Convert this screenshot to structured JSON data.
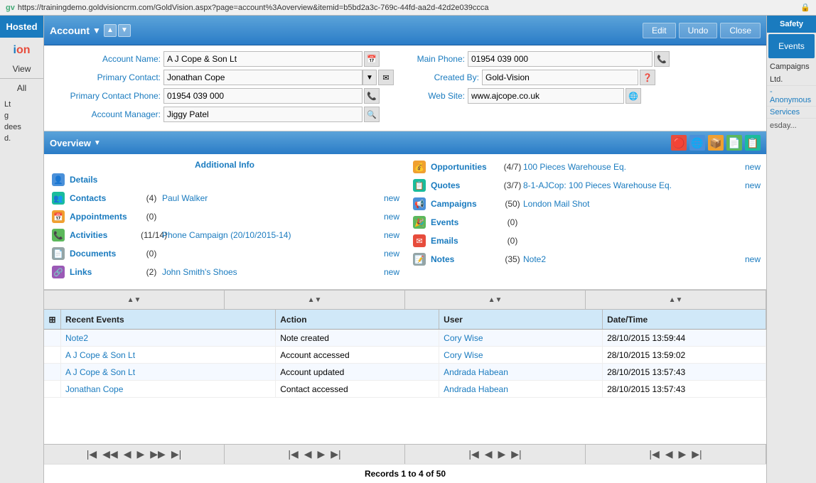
{
  "browser": {
    "url": "https://trainingdemo.goldvisioncrm.com/GoldVision.aspx?page=account%3Aoverview&itemid=b5bd2a3c-769c-44fd-aa2d-42d2e039ccca",
    "favicon": "gv"
  },
  "sidebar": {
    "hosted_label": "Hosted",
    "logo": "ion",
    "view_label": "View",
    "all_label": "All",
    "items": [
      {
        "label": "Lt"
      },
      {
        "label": "g"
      },
      {
        "label": "dees"
      },
      {
        "label": "d."
      }
    ]
  },
  "account": {
    "title": "Account",
    "dropdown_icon": "▼",
    "up_icon": "▲",
    "down_icon": "▼",
    "edit_label": "Edit",
    "undo_label": "Undo",
    "close_label": "Close"
  },
  "form": {
    "account_name_label": "Account Name:",
    "account_name_value": "A J Cope & Son Lt",
    "primary_contact_label": "Primary Contact:",
    "primary_contact_value": "Jonathan Cope",
    "primary_contact_phone_label": "Primary Contact Phone:",
    "primary_contact_phone_value": "01954 039 000",
    "account_manager_label": "Account Manager:",
    "account_manager_value": "Jiggy Patel",
    "main_phone_label": "Main Phone:",
    "main_phone_value": "01954 039 000",
    "created_by_label": "Created By:",
    "created_by_value": "Gold-Vision",
    "web_site_label": "Web Site:",
    "web_site_value": "www.ajcope.co.uk"
  },
  "overview": {
    "title": "Overview",
    "dropdown_icon": "▼",
    "icons": [
      "🔴",
      "🌐",
      "📦",
      "📄",
      "📋"
    ]
  },
  "overview_left": {
    "additional_info_title": "Additional Info",
    "items": [
      {
        "icon": "👤",
        "label": "Details",
        "count": "",
        "link": "",
        "new_label": ""
      },
      {
        "icon": "👥",
        "label": "Contacts",
        "count": "(4)",
        "link": "Paul Walker",
        "new_label": "new"
      },
      {
        "icon": "📅",
        "label": "Appointments",
        "count": "(0)",
        "link": "",
        "new_label": "new"
      },
      {
        "icon": "📞",
        "label": "Activities",
        "count": "(11/14)",
        "link": "Phone Campaign (20/10/2015-14)",
        "new_label": "new"
      },
      {
        "icon": "📄",
        "label": "Documents",
        "count": "(0)",
        "link": "",
        "new_label": "new"
      },
      {
        "icon": "🔗",
        "label": "Links",
        "count": "(2)",
        "link": "John Smith's Shoes",
        "new_label": "new"
      }
    ]
  },
  "overview_right": {
    "items": [
      {
        "icon": "💰",
        "label": "Opportunities",
        "count": "(4/7)",
        "link": "100 Pieces Warehouse Eq.",
        "new_label": "new"
      },
      {
        "icon": "📋",
        "label": "Quotes",
        "count": "(3/7)",
        "link": "8-1-AJCop: 100 Pieces Warehouse Eq.",
        "new_label": "new"
      },
      {
        "icon": "📢",
        "label": "Campaigns",
        "count": "(50)",
        "link": "London Mail Shot",
        "new_label": ""
      },
      {
        "icon": "🎉",
        "label": "Events",
        "count": "(0)",
        "link": "",
        "new_label": ""
      },
      {
        "icon": "✉️",
        "label": "Emails",
        "count": "(0)",
        "link": "",
        "new_label": ""
      },
      {
        "icon": "📝",
        "label": "Notes",
        "count": "(35)",
        "link": "Note2",
        "new_label": "new"
      }
    ]
  },
  "sort_columns": [
    "",
    "",
    "",
    ""
  ],
  "table": {
    "expand_icon": "⊞",
    "headers": {
      "recent_events": "Recent Events",
      "action": "Action",
      "user": "User",
      "datetime": "Date/Time"
    },
    "rows": [
      {
        "name": "Note2",
        "action": "Note created",
        "user": "Cory Wise",
        "datetime": "28/10/2015 13:59:44"
      },
      {
        "name": "A J Cope & Son Lt",
        "action": "Account accessed",
        "user": "Cory Wise",
        "datetime": "28/10/2015 13:59:02"
      },
      {
        "name": "A J Cope & Son Lt",
        "action": "Account updated",
        "user": "Andrada Habean",
        "datetime": "28/10/2015 13:57:43"
      },
      {
        "name": "Jonathan Cope",
        "action": "Contact accessed",
        "user": "Andrada Habean",
        "datetime": "28/10/2015 13:57:43"
      }
    ]
  },
  "navigation": {
    "first": "⏮",
    "prev_page": "◀◀",
    "prev": "◀",
    "next": "▶",
    "next_page": "▶▶",
    "last": "⏭"
  },
  "records": {
    "text": "Records 1 to 4 of 50"
  },
  "right_sidebar": {
    "safety_label": "Safety",
    "events_label": "Events",
    "campaigns_label": "Campaigns",
    "items": [
      {
        "label": "Ltd."
      },
      {
        "label": "- Anonymous"
      },
      {
        "label": "Services"
      }
    ],
    "day_label": "esday..."
  }
}
